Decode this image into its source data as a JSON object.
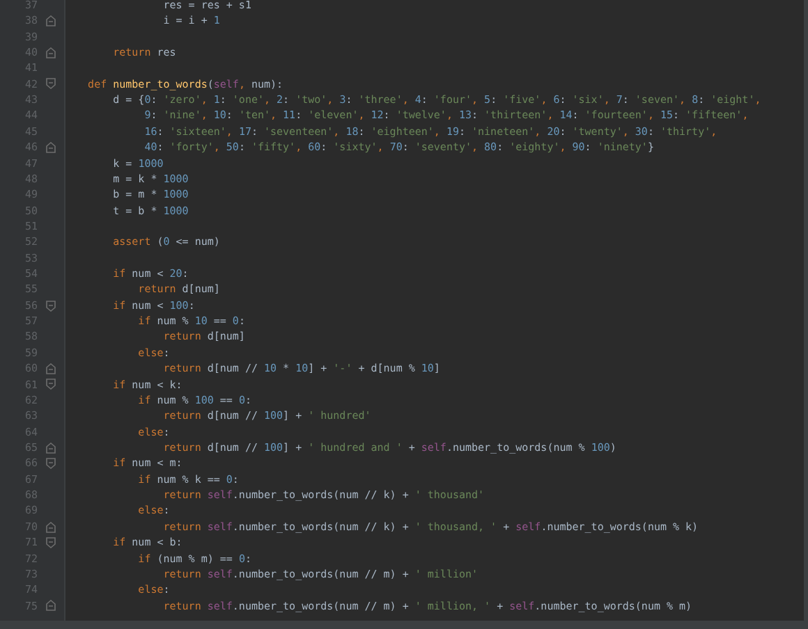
{
  "editor": {
    "lines": [
      {
        "number": "37",
        "tokens": [
          {
            "kind": "txt",
            "text": "                res = res + s1"
          }
        ]
      },
      {
        "number": "38",
        "fold_marker": {
          "kind": "end"
        },
        "tokens": [
          {
            "kind": "txt",
            "text": "                i = i + "
          },
          {
            "kind": "num",
            "text": "1"
          }
        ]
      },
      {
        "number": "39"
      },
      {
        "number": "40",
        "fold_marker": {
          "kind": "end"
        },
        "tokens": [
          {
            "kind": "kw",
            "text": "        return "
          },
          {
            "kind": "txt",
            "text": "res"
          }
        ]
      },
      {
        "number": "41"
      },
      {
        "number": "42",
        "fold_marker": {
          "kind": "start"
        },
        "tokens": [
          {
            "kind": "kw",
            "text": "    def "
          },
          {
            "kind": "fn",
            "text": "number_to_words"
          },
          {
            "kind": "txt",
            "text": "("
          },
          {
            "kind": "self",
            "text": "self"
          },
          {
            "kind": "punct",
            "text": ", "
          },
          {
            "kind": "txt",
            "text": "num):"
          }
        ]
      },
      {
        "number": "43",
        "tokens": [
          {
            "kind": "txt",
            "text": "        d = {"
          },
          {
            "kind": "num",
            "text": "0"
          },
          {
            "kind": "txt",
            "text": ": "
          },
          {
            "kind": "str",
            "text": "'zero'"
          },
          {
            "kind": "punct",
            "text": ", "
          },
          {
            "kind": "num",
            "text": "1"
          },
          {
            "kind": "txt",
            "text": ": "
          },
          {
            "kind": "str",
            "text": "'one'"
          },
          {
            "kind": "punct",
            "text": ", "
          },
          {
            "kind": "num",
            "text": "2"
          },
          {
            "kind": "txt",
            "text": ": "
          },
          {
            "kind": "str",
            "text": "'two'"
          },
          {
            "kind": "punct",
            "text": ", "
          },
          {
            "kind": "num",
            "text": "3"
          },
          {
            "kind": "txt",
            "text": ": "
          },
          {
            "kind": "str",
            "text": "'three'"
          },
          {
            "kind": "punct",
            "text": ", "
          },
          {
            "kind": "num",
            "text": "4"
          },
          {
            "kind": "txt",
            "text": ": "
          },
          {
            "kind": "str",
            "text": "'four'"
          },
          {
            "kind": "punct",
            "text": ", "
          },
          {
            "kind": "num",
            "text": "5"
          },
          {
            "kind": "txt",
            "text": ": "
          },
          {
            "kind": "str",
            "text": "'five'"
          },
          {
            "kind": "punct",
            "text": ", "
          },
          {
            "kind": "num",
            "text": "6"
          },
          {
            "kind": "txt",
            "text": ": "
          },
          {
            "kind": "str",
            "text": "'six'"
          },
          {
            "kind": "punct",
            "text": ", "
          },
          {
            "kind": "num",
            "text": "7"
          },
          {
            "kind": "txt",
            "text": ": "
          },
          {
            "kind": "str",
            "text": "'seven'"
          },
          {
            "kind": "punct",
            "text": ", "
          },
          {
            "kind": "num",
            "text": "8"
          },
          {
            "kind": "txt",
            "text": ": "
          },
          {
            "kind": "str",
            "text": "'eight'"
          },
          {
            "kind": "punct",
            "text": ","
          }
        ]
      },
      {
        "number": "44",
        "tokens": [
          {
            "kind": "num",
            "text": "             9"
          },
          {
            "kind": "txt",
            "text": ": "
          },
          {
            "kind": "str",
            "text": "'nine'"
          },
          {
            "kind": "punct",
            "text": ", "
          },
          {
            "kind": "num",
            "text": "10"
          },
          {
            "kind": "txt",
            "text": ": "
          },
          {
            "kind": "str",
            "text": "'ten'"
          },
          {
            "kind": "punct",
            "text": ", "
          },
          {
            "kind": "num",
            "text": "11"
          },
          {
            "kind": "txt",
            "text": ": "
          },
          {
            "kind": "str",
            "text": "'eleven'"
          },
          {
            "kind": "punct",
            "text": ", "
          },
          {
            "kind": "num",
            "text": "12"
          },
          {
            "kind": "txt",
            "text": ": "
          },
          {
            "kind": "str",
            "text": "'twelve'"
          },
          {
            "kind": "punct",
            "text": ", "
          },
          {
            "kind": "num",
            "text": "13"
          },
          {
            "kind": "txt",
            "text": ": "
          },
          {
            "kind": "str",
            "text": "'thirteen'"
          },
          {
            "kind": "punct",
            "text": ", "
          },
          {
            "kind": "num",
            "text": "14"
          },
          {
            "kind": "txt",
            "text": ": "
          },
          {
            "kind": "str",
            "text": "'fourteen'"
          },
          {
            "kind": "punct",
            "text": ", "
          },
          {
            "kind": "num",
            "text": "15"
          },
          {
            "kind": "txt",
            "text": ": "
          },
          {
            "kind": "str",
            "text": "'fifteen'"
          },
          {
            "kind": "punct",
            "text": ","
          }
        ]
      },
      {
        "number": "45",
        "tokens": [
          {
            "kind": "num",
            "text": "             16"
          },
          {
            "kind": "txt",
            "text": ": "
          },
          {
            "kind": "str",
            "text": "'sixteen'"
          },
          {
            "kind": "punct",
            "text": ", "
          },
          {
            "kind": "num",
            "text": "17"
          },
          {
            "kind": "txt",
            "text": ": "
          },
          {
            "kind": "str",
            "text": "'seventeen'"
          },
          {
            "kind": "punct",
            "text": ", "
          },
          {
            "kind": "num",
            "text": "18"
          },
          {
            "kind": "txt",
            "text": ": "
          },
          {
            "kind": "str",
            "text": "'eighteen'"
          },
          {
            "kind": "punct",
            "text": ", "
          },
          {
            "kind": "num",
            "text": "19"
          },
          {
            "kind": "txt",
            "text": ": "
          },
          {
            "kind": "str",
            "text": "'nineteen'"
          },
          {
            "kind": "punct",
            "text": ", "
          },
          {
            "kind": "num",
            "text": "20"
          },
          {
            "kind": "txt",
            "text": ": "
          },
          {
            "kind": "str",
            "text": "'twenty'"
          },
          {
            "kind": "punct",
            "text": ", "
          },
          {
            "kind": "num",
            "text": "30"
          },
          {
            "kind": "txt",
            "text": ": "
          },
          {
            "kind": "str",
            "text": "'thirty'"
          },
          {
            "kind": "punct",
            "text": ","
          }
        ]
      },
      {
        "number": "46",
        "fold_marker": {
          "kind": "end"
        },
        "tokens": [
          {
            "kind": "num",
            "text": "             40"
          },
          {
            "kind": "txt",
            "text": ": "
          },
          {
            "kind": "str",
            "text": "'forty'"
          },
          {
            "kind": "punct",
            "text": ", "
          },
          {
            "kind": "num",
            "text": "50"
          },
          {
            "kind": "txt",
            "text": ": "
          },
          {
            "kind": "str",
            "text": "'fifty'"
          },
          {
            "kind": "punct",
            "text": ", "
          },
          {
            "kind": "num",
            "text": "60"
          },
          {
            "kind": "txt",
            "text": ": "
          },
          {
            "kind": "str",
            "text": "'sixty'"
          },
          {
            "kind": "punct",
            "text": ", "
          },
          {
            "kind": "num",
            "text": "70"
          },
          {
            "kind": "txt",
            "text": ": "
          },
          {
            "kind": "str",
            "text": "'seventy'"
          },
          {
            "kind": "punct",
            "text": ", "
          },
          {
            "kind": "num",
            "text": "80"
          },
          {
            "kind": "txt",
            "text": ": "
          },
          {
            "kind": "str",
            "text": "'eighty'"
          },
          {
            "kind": "punct",
            "text": ", "
          },
          {
            "kind": "num",
            "text": "90"
          },
          {
            "kind": "txt",
            "text": ": "
          },
          {
            "kind": "str",
            "text": "'ninety'"
          },
          {
            "kind": "txt",
            "text": "}"
          }
        ]
      },
      {
        "number": "47",
        "tokens": [
          {
            "kind": "txt",
            "text": "        k = "
          },
          {
            "kind": "num",
            "text": "1000"
          }
        ]
      },
      {
        "number": "48",
        "tokens": [
          {
            "kind": "txt",
            "text": "        m = k * "
          },
          {
            "kind": "num",
            "text": "1000"
          }
        ]
      },
      {
        "number": "49",
        "tokens": [
          {
            "kind": "txt",
            "text": "        b = m * "
          },
          {
            "kind": "num",
            "text": "1000"
          }
        ]
      },
      {
        "number": "50",
        "tokens": [
          {
            "kind": "txt",
            "text": "        t = b * "
          },
          {
            "kind": "num",
            "text": "1000"
          }
        ]
      },
      {
        "number": "51"
      },
      {
        "number": "52",
        "tokens": [
          {
            "kind": "kw",
            "text": "        assert "
          },
          {
            "kind": "txt",
            "text": "("
          },
          {
            "kind": "num",
            "text": "0"
          },
          {
            "kind": "txt",
            "text": " <= num)"
          }
        ]
      },
      {
        "number": "53"
      },
      {
        "number": "54",
        "tokens": [
          {
            "kind": "kw",
            "text": "        if "
          },
          {
            "kind": "txt",
            "text": "num < "
          },
          {
            "kind": "num",
            "text": "20"
          },
          {
            "kind": "txt",
            "text": ":"
          }
        ]
      },
      {
        "number": "55",
        "tokens": [
          {
            "kind": "kw",
            "text": "            return "
          },
          {
            "kind": "txt",
            "text": "d[num]"
          }
        ]
      },
      {
        "number": "56",
        "fold_marker": {
          "kind": "start"
        },
        "tokens": [
          {
            "kind": "kw",
            "text": "        if "
          },
          {
            "kind": "txt",
            "text": "num < "
          },
          {
            "kind": "num",
            "text": "100"
          },
          {
            "kind": "txt",
            "text": ":"
          }
        ]
      },
      {
        "number": "57",
        "tokens": [
          {
            "kind": "kw",
            "text": "            if "
          },
          {
            "kind": "txt",
            "text": "num % "
          },
          {
            "kind": "num",
            "text": "10"
          },
          {
            "kind": "txt",
            "text": " == "
          },
          {
            "kind": "num",
            "text": "0"
          },
          {
            "kind": "txt",
            "text": ":"
          }
        ]
      },
      {
        "number": "58",
        "tokens": [
          {
            "kind": "kw",
            "text": "                return "
          },
          {
            "kind": "txt",
            "text": "d[num]"
          }
        ]
      },
      {
        "number": "59",
        "tokens": [
          {
            "kind": "kw",
            "text": "            else"
          },
          {
            "kind": "txt",
            "text": ":"
          }
        ]
      },
      {
        "number": "60",
        "fold_marker": {
          "kind": "end"
        },
        "tokens": [
          {
            "kind": "kw",
            "text": "                return "
          },
          {
            "kind": "txt",
            "text": "d[num // "
          },
          {
            "kind": "num",
            "text": "10"
          },
          {
            "kind": "txt",
            "text": " * "
          },
          {
            "kind": "num",
            "text": "10"
          },
          {
            "kind": "txt",
            "text": "] + "
          },
          {
            "kind": "str",
            "text": "'-'"
          },
          {
            "kind": "txt",
            "text": " + d[num % "
          },
          {
            "kind": "num",
            "text": "10"
          },
          {
            "kind": "txt",
            "text": "]"
          }
        ]
      },
      {
        "number": "61",
        "fold_marker": {
          "kind": "start"
        },
        "tokens": [
          {
            "kind": "kw",
            "text": "        if "
          },
          {
            "kind": "txt",
            "text": "num < k:"
          }
        ]
      },
      {
        "number": "62",
        "tokens": [
          {
            "kind": "kw",
            "text": "            if "
          },
          {
            "kind": "txt",
            "text": "num % "
          },
          {
            "kind": "num",
            "text": "100"
          },
          {
            "kind": "txt",
            "text": " == "
          },
          {
            "kind": "num",
            "text": "0"
          },
          {
            "kind": "txt",
            "text": ":"
          }
        ]
      },
      {
        "number": "63",
        "tokens": [
          {
            "kind": "kw",
            "text": "                return "
          },
          {
            "kind": "txt",
            "text": "d[num // "
          },
          {
            "kind": "num",
            "text": "100"
          },
          {
            "kind": "txt",
            "text": "] + "
          },
          {
            "kind": "str",
            "text": "' hundred'"
          }
        ]
      },
      {
        "number": "64",
        "tokens": [
          {
            "kind": "kw",
            "text": "            else"
          },
          {
            "kind": "txt",
            "text": ":"
          }
        ]
      },
      {
        "number": "65",
        "fold_marker": {
          "kind": "end"
        },
        "tokens": [
          {
            "kind": "kw",
            "text": "                return "
          },
          {
            "kind": "txt",
            "text": "d[num // "
          },
          {
            "kind": "num",
            "text": "100"
          },
          {
            "kind": "txt",
            "text": "] + "
          },
          {
            "kind": "str",
            "text": "' hundred and '"
          },
          {
            "kind": "txt",
            "text": " + "
          },
          {
            "kind": "self",
            "text": "self"
          },
          {
            "kind": "txt",
            "text": ".number_to_words(num % "
          },
          {
            "kind": "num",
            "text": "100"
          },
          {
            "kind": "txt",
            "text": ")"
          }
        ]
      },
      {
        "number": "66",
        "fold_marker": {
          "kind": "start"
        },
        "tokens": [
          {
            "kind": "kw",
            "text": "        if "
          },
          {
            "kind": "txt",
            "text": "num < m:"
          }
        ]
      },
      {
        "number": "67",
        "tokens": [
          {
            "kind": "kw",
            "text": "            if "
          },
          {
            "kind": "txt",
            "text": "num % k == "
          },
          {
            "kind": "num",
            "text": "0"
          },
          {
            "kind": "txt",
            "text": ":"
          }
        ]
      },
      {
        "number": "68",
        "tokens": [
          {
            "kind": "kw",
            "text": "                return "
          },
          {
            "kind": "self",
            "text": "self"
          },
          {
            "kind": "txt",
            "text": ".number_to_words(num // k) + "
          },
          {
            "kind": "str",
            "text": "' thousand'"
          }
        ]
      },
      {
        "number": "69",
        "tokens": [
          {
            "kind": "kw",
            "text": "            else"
          },
          {
            "kind": "txt",
            "text": ":"
          }
        ]
      },
      {
        "number": "70",
        "fold_marker": {
          "kind": "end"
        },
        "tokens": [
          {
            "kind": "kw",
            "text": "                return "
          },
          {
            "kind": "self",
            "text": "self"
          },
          {
            "kind": "txt",
            "text": ".number_to_words(num // k) + "
          },
          {
            "kind": "str",
            "text": "' thousand, '"
          },
          {
            "kind": "txt",
            "text": " + "
          },
          {
            "kind": "self",
            "text": "self"
          },
          {
            "kind": "txt",
            "text": ".number_to_words(num % k)"
          }
        ]
      },
      {
        "number": "71",
        "fold_marker": {
          "kind": "start"
        },
        "tokens": [
          {
            "kind": "kw",
            "text": "        if "
          },
          {
            "kind": "txt",
            "text": "num < b:"
          }
        ]
      },
      {
        "number": "72",
        "tokens": [
          {
            "kind": "kw",
            "text": "            if "
          },
          {
            "kind": "txt",
            "text": "(num % m) == "
          },
          {
            "kind": "num",
            "text": "0"
          },
          {
            "kind": "txt",
            "text": ":"
          }
        ]
      },
      {
        "number": "73",
        "tokens": [
          {
            "kind": "kw",
            "text": "                return "
          },
          {
            "kind": "self",
            "text": "self"
          },
          {
            "kind": "txt",
            "text": ".number_to_words(num // m) + "
          },
          {
            "kind": "str",
            "text": "' million'"
          }
        ]
      },
      {
        "number": "74",
        "tokens": [
          {
            "kind": "kw",
            "text": "            else"
          },
          {
            "kind": "txt",
            "text": ":"
          }
        ]
      },
      {
        "number": "75",
        "fold_marker": {
          "kind": "end"
        },
        "tokens": [
          {
            "kind": "kw",
            "text": "                return "
          },
          {
            "kind": "self",
            "text": "self"
          },
          {
            "kind": "txt",
            "text": ".number_to_words(num // m) + "
          },
          {
            "kind": "str",
            "text": "' million, '"
          },
          {
            "kind": "txt",
            "text": " + "
          },
          {
            "kind": "self",
            "text": "self"
          },
          {
            "kind": "txt",
            "text": ".number_to_words(num % m)"
          }
        ]
      }
    ]
  }
}
